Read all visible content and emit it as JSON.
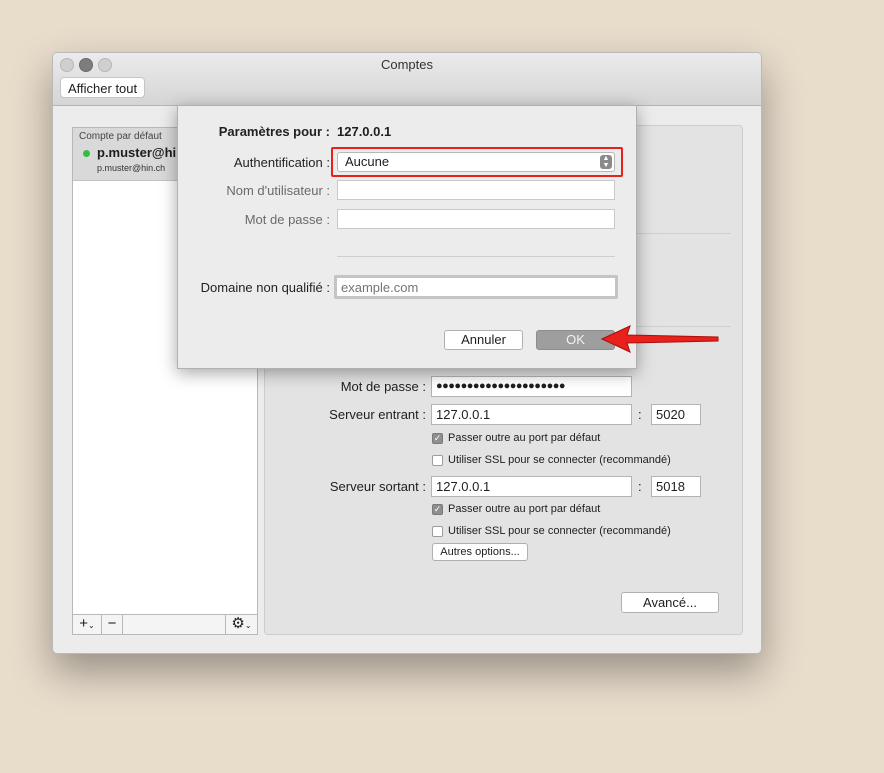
{
  "window": {
    "title": "Comptes",
    "toolbar": {
      "show_all_label": "Afficher tout"
    }
  },
  "sidebar": {
    "header": "Compte par défaut",
    "account_name": "p.muster@hin",
    "account_email": "p.muster@hin.ch",
    "add_label": "+",
    "remove_label": "−",
    "gear_label": "⚙"
  },
  "panel": {
    "password_label": "Mot de passe :",
    "password_value": "●●●●●●●●●●●●●●●●●●●●●",
    "incoming_label": "Serveur entrant :",
    "incoming_server": "127.0.0.1",
    "incoming_port": "5020",
    "override_port_label": "Passer outre au port par défaut",
    "ssl_label": "Utiliser SSL pour se connecter (recommandé)",
    "outgoing_label": "Serveur sortant :",
    "outgoing_server": "127.0.0.1",
    "outgoing_port": "5018",
    "more_options_label": "Autres options...",
    "advanced_label": "Avancé...",
    "colon": ":",
    "incoming_override_checked": true,
    "incoming_ssl_checked": false,
    "outgoing_override_checked": true,
    "outgoing_ssl_checked": false
  },
  "sheet": {
    "params_label": "Paramètres pour :",
    "params_value": "127.0.0.1",
    "auth_label": "Authentification :",
    "auth_value": "Aucune",
    "username_label": "Nom d'utilisateur :",
    "password_label": "Mot de passe :",
    "domain_label": "Domaine non qualifié :",
    "domain_placeholder": "example.com",
    "cancel_label": "Annuler",
    "ok_label": "OK"
  },
  "colors": {
    "highlight": "#e8211c",
    "arrow": "#e8211c",
    "status_dot": "#2fbf3a"
  }
}
